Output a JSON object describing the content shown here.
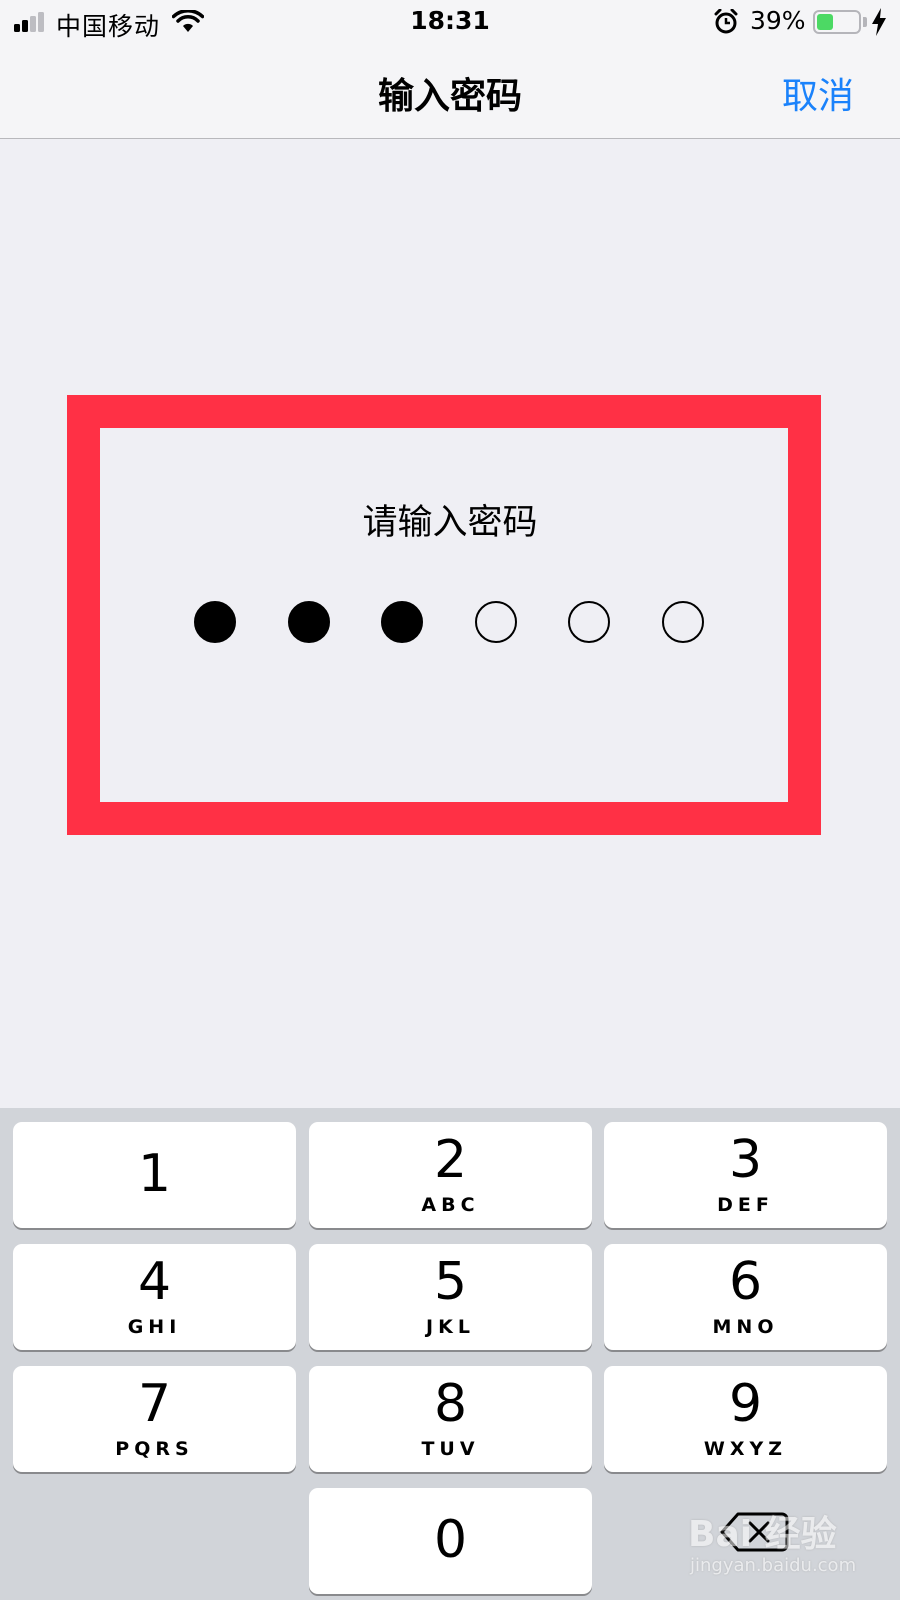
{
  "status_bar": {
    "carrier": "中国移动",
    "time": "18:31",
    "battery_percent_label": "39%",
    "battery_level": 0.39,
    "icons": [
      "signal-icon",
      "wifi-icon",
      "alarm-icon",
      "battery-icon",
      "charging-icon"
    ]
  },
  "nav": {
    "title": "输入密码",
    "cancel_label": "取消"
  },
  "passcode": {
    "prompt": "请输入密码",
    "length": 6,
    "entered": 3
  },
  "keypad": {
    "keys": [
      {
        "digit": "1",
        "letters": ""
      },
      {
        "digit": "2",
        "letters": "ABC"
      },
      {
        "digit": "3",
        "letters": "DEF"
      },
      {
        "digit": "4",
        "letters": "GHI"
      },
      {
        "digit": "5",
        "letters": "JKL"
      },
      {
        "digit": "6",
        "letters": "MNO"
      },
      {
        "digit": "7",
        "letters": "PQRS"
      },
      {
        "digit": "8",
        "letters": "TUV"
      },
      {
        "digit": "9",
        "letters": "WXYZ"
      },
      {
        "digit": "0",
        "letters": ""
      }
    ],
    "delete_icon": "backspace-icon"
  },
  "watermark": {
    "logo_text": "Bai 经验",
    "url": "jingyan.baidu.com"
  },
  "colors": {
    "accent": "#1a82fb",
    "highlight": "#ff3045",
    "battery": "#4cd964",
    "background": "#efeff4",
    "keypad_background": "#d1d4d9"
  }
}
